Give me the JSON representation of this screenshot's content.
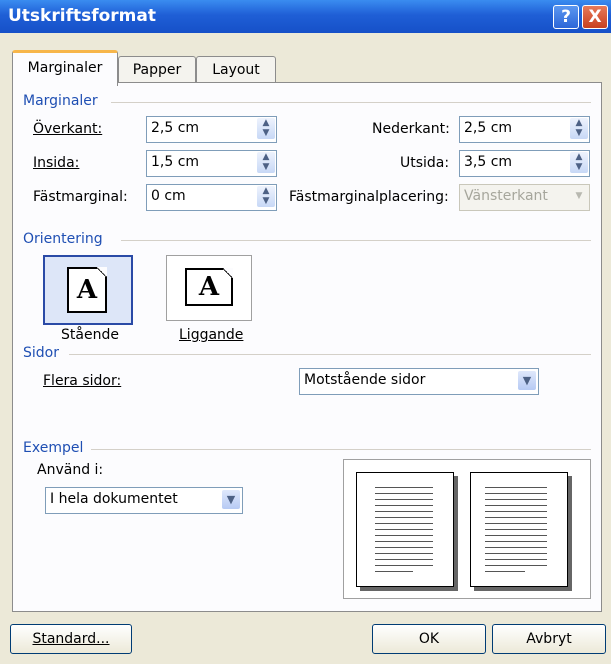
{
  "window": {
    "title": "Utskriftsformat"
  },
  "title_buttons": {
    "help": "?",
    "close": "X"
  },
  "tabs": [
    {
      "label": "Marginaler",
      "active": true
    },
    {
      "label": "Papper",
      "active": false
    },
    {
      "label": "Layout",
      "active": false
    }
  ],
  "margins": {
    "heading": "Marginaler",
    "top": {
      "label": "Överkant:",
      "value": "2,5 cm"
    },
    "bottom": {
      "label": "Nederkant:",
      "value": "2,5 cm"
    },
    "inside": {
      "label": "Insida:",
      "value": "1,5 cm"
    },
    "outside": {
      "label": "Utsida:",
      "value": "3,5 cm"
    },
    "gutter": {
      "label": "Fästmarginal:",
      "value": "0 cm"
    },
    "gutter_pos": {
      "label": "Fästmarginalplacering:",
      "value": "Vänsterkant",
      "enabled": false
    }
  },
  "orientation": {
    "heading": "Orientering",
    "portrait": {
      "label": "Stående",
      "selected": true
    },
    "landscape": {
      "label": "Liggande",
      "selected": false
    },
    "page_glyph": "A"
  },
  "pages": {
    "heading": "Sidor",
    "multiple_label": "Flera sidor:",
    "multiple_value": "Motstående sidor"
  },
  "preview": {
    "heading": "Exempel",
    "apply_label": "Använd i:",
    "apply_value": "I hela dokumentet"
  },
  "buttons": {
    "default": "Standard...",
    "ok": "OK",
    "cancel": "Avbryt"
  },
  "colors": {
    "titlebar": "#1f5fd6",
    "section_heading": "#1f4fb3",
    "active_tab_accent": "#f7b64a"
  },
  "icons": [
    "help-icon",
    "close-icon",
    "spin-arrows-icon",
    "dropdown-chevron-icon",
    "portrait-page-icon",
    "landscape-page-icon"
  ]
}
